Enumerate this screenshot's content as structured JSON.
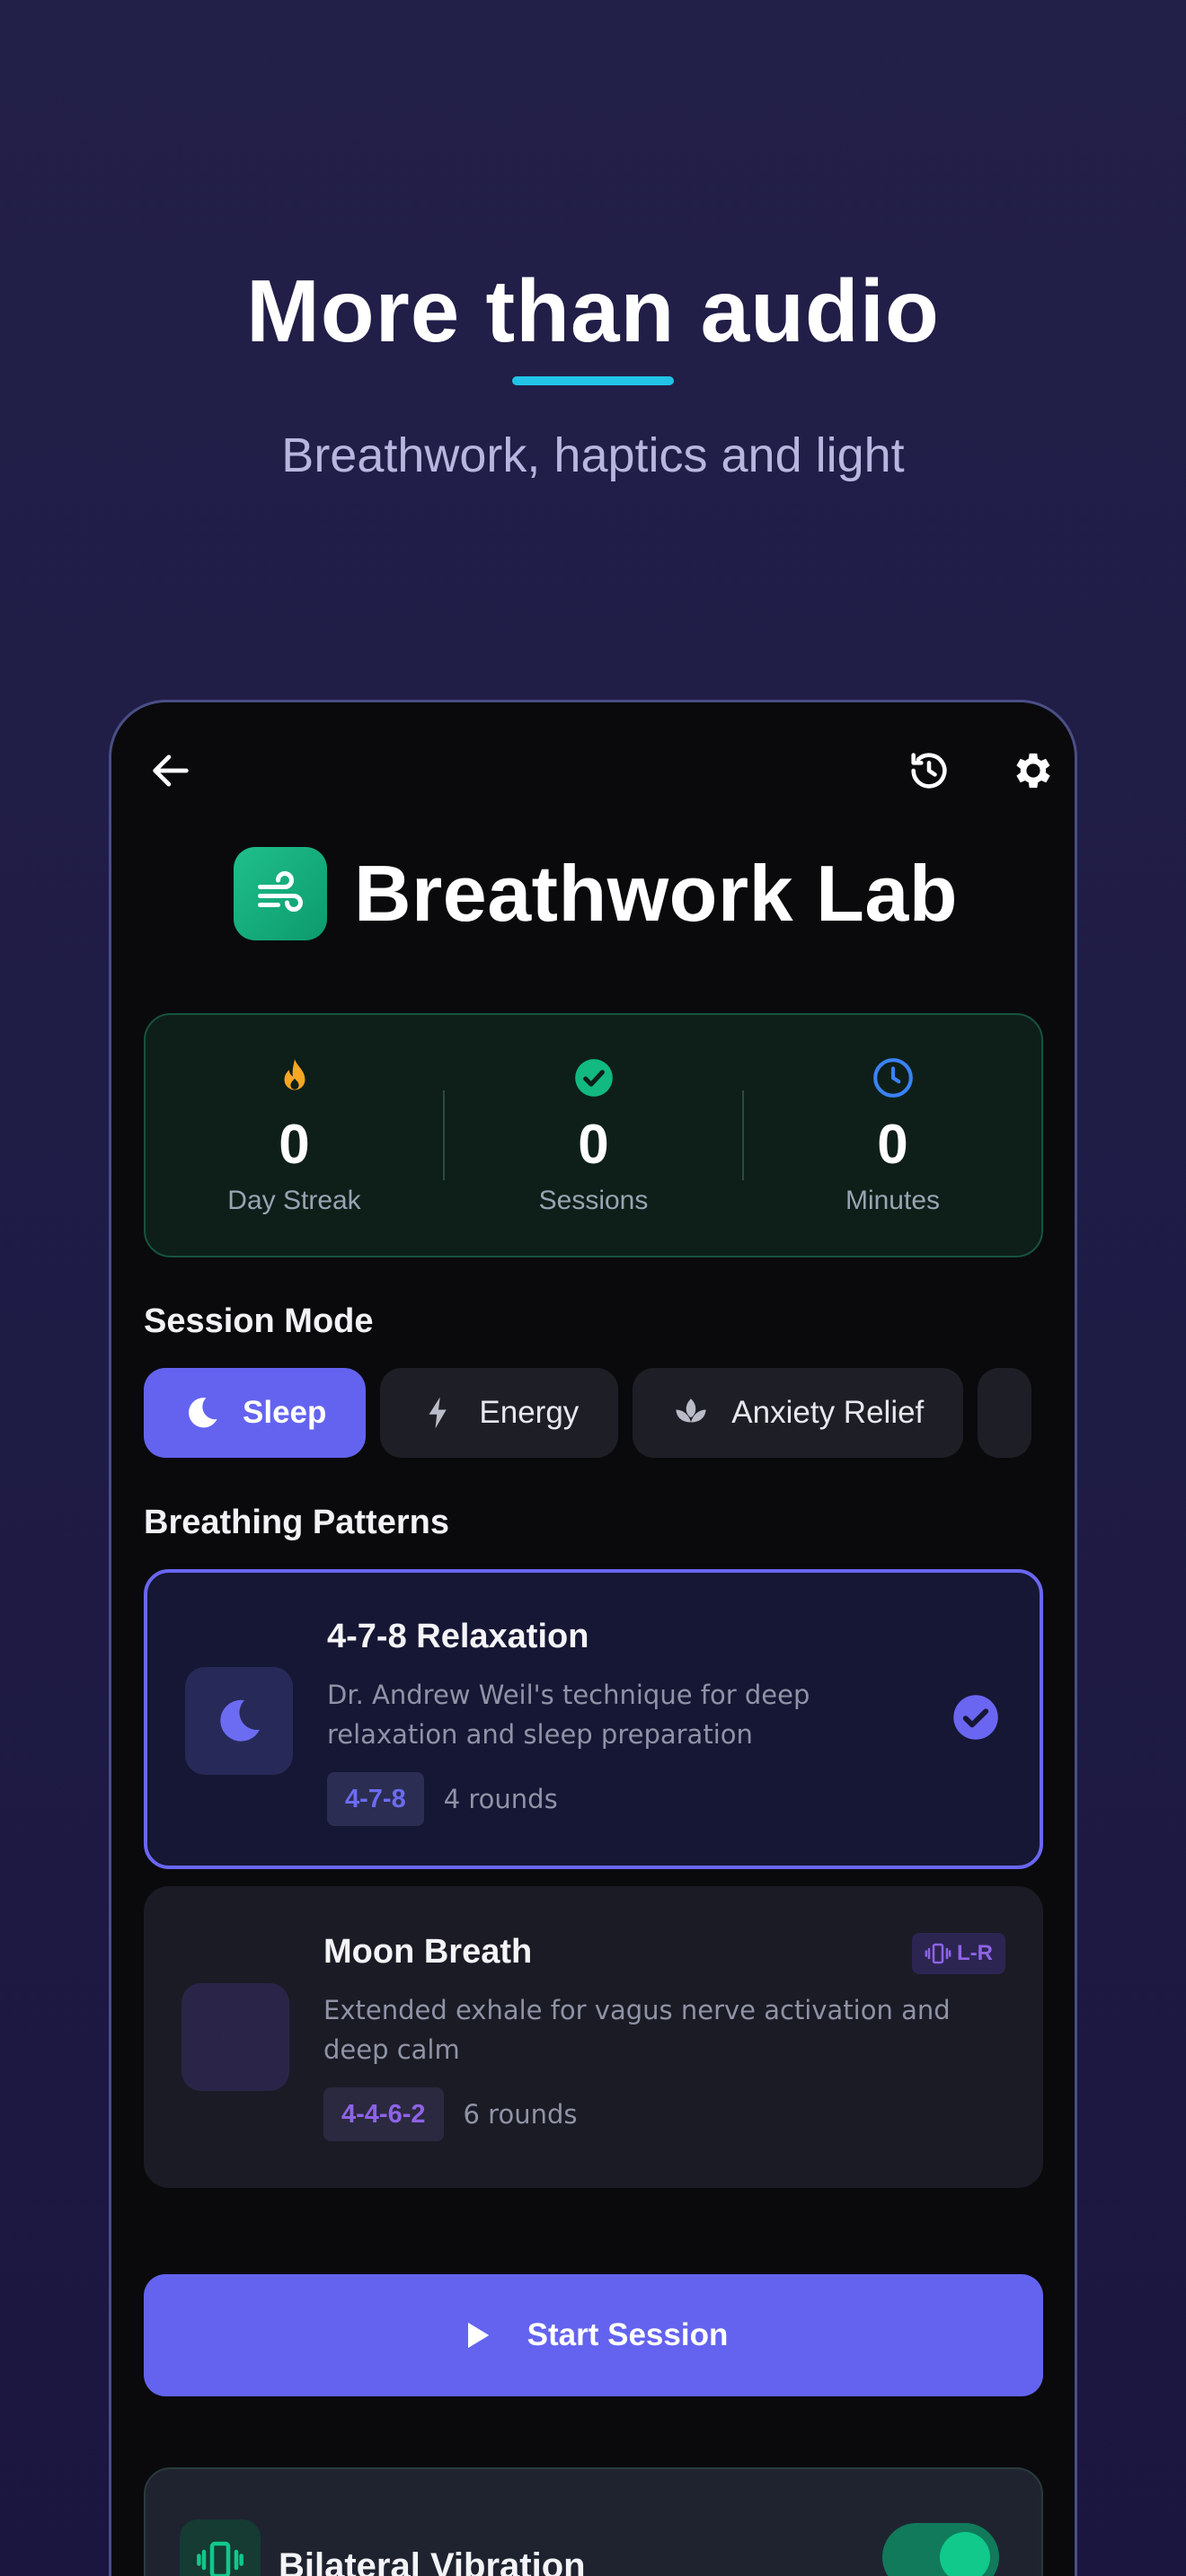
{
  "hero": {
    "title": "More than audio",
    "subtitle": "Breathwork, haptics and light",
    "accent_color": "#22c3e6"
  },
  "app": {
    "title": "Breathwork Lab",
    "logo_icon": "wind-icon",
    "toolbar_icons": [
      "back-arrow-icon",
      "history-icon",
      "gear-icon"
    ]
  },
  "stats": [
    {
      "icon": "flame-icon",
      "value": "0",
      "label": "Day Streak",
      "color": "#f5a623"
    },
    {
      "icon": "check-circle-icon",
      "value": "0",
      "label": "Sessions",
      "color": "#12b981"
    },
    {
      "icon": "clock-icon",
      "value": "0",
      "label": "Minutes",
      "color": "#3b82f6"
    }
  ],
  "session_mode": {
    "title": "Session Mode",
    "modes": [
      {
        "label": "Sleep",
        "icon": "moon-icon",
        "active": true
      },
      {
        "label": "Energy",
        "icon": "bolt-icon",
        "active": false
      },
      {
        "label": "Anxiety Relief",
        "icon": "lotus-icon",
        "active": false
      }
    ]
  },
  "breathing_patterns": {
    "title": "Breathing Patterns",
    "items": [
      {
        "title": "4-7-8 Relaxation",
        "description": "Dr. Andrew Weil's technique for deep relaxation and sleep preparation",
        "pattern": "4-7-8",
        "rounds": "4 rounds",
        "selected": true,
        "icon": "moon-icon"
      },
      {
        "title": "Moon Breath",
        "description": "Extended exhale for vagus nerve activation and deep calm",
        "pattern": "4-4-6-2",
        "rounds": "6 rounds",
        "selected": false,
        "badge": "L-R",
        "badge_icon": "vibrate-icon",
        "icon": "moon-icon"
      }
    ]
  },
  "start_button": {
    "label": "Start Session",
    "icon": "play-icon",
    "color": "#6363f0"
  },
  "bilateral": {
    "title": "Bilateral Vibration",
    "icon": "vibrate-icon",
    "enabled": true
  }
}
